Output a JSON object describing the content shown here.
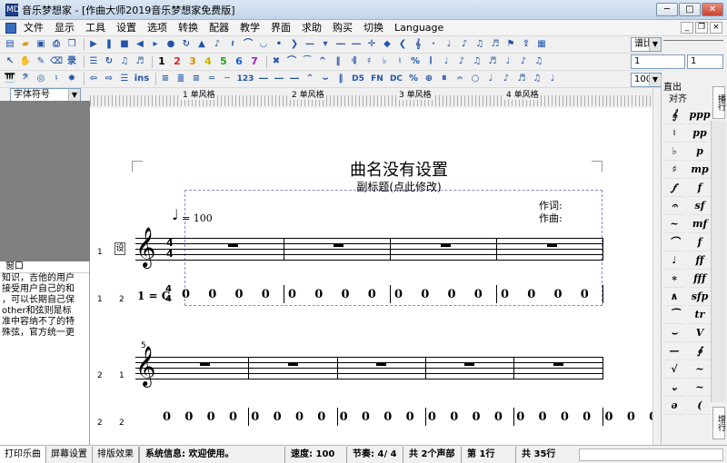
{
  "window": {
    "app_name": "音乐梦想家",
    "title": "音乐梦想家 - [作曲大师2019音乐梦想家免费版]",
    "app_icon_text": "MD"
  },
  "menu": {
    "items": [
      "文件",
      "显示",
      "工具",
      "设置",
      "选项",
      "转换",
      "配器",
      "教学",
      "界面",
      "求助",
      "购买",
      "切换",
      "Language"
    ]
  },
  "toolbar": {
    "row2_numbers": [
      "1",
      "2",
      "3",
      "4",
      "5",
      "6",
      "7"
    ],
    "row3_labels": [
      "ins",
      "123",
      "D5",
      "FN",
      "DC",
      "%"
    ],
    "dropdown_right_1": "谱比",
    "input_right_2a": "1",
    "input_right_2b": "1",
    "zoom": "100%",
    "straight_label": "直出",
    "align_label": "对齐"
  },
  "left_panel": {
    "dropdown": "字体符号",
    "window_header": "窗口",
    "text_lines": [
      "知识，吉他的用户",
      "接受用户自己的和",
      "，可以长期自己保",
      "other和弦则是标",
      "准中容纳不了的特",
      "殊弦，官方统一更"
    ]
  },
  "ruler": {
    "segments": [
      "1  单风格",
      "2  单风格",
      "3  单风格",
      "4  单风格"
    ]
  },
  "score": {
    "title": "曲名没有设置",
    "subtitle": "副标题(点此修改)",
    "lyricist_label": "作词:",
    "composer_label": "作曲:",
    "tempo": "= 100",
    "key_label": "1 = C",
    "time_sig_top": "4",
    "time_sig_bottom": "4",
    "set_box": "设",
    "measure_number_2": "5",
    "row_labels": [
      {
        "part": "1",
        "staff": "1"
      },
      {
        "part": "1",
        "staff": "2"
      },
      {
        "part": "2",
        "staff": "1"
      },
      {
        "part": "2",
        "staff": "2"
      }
    ],
    "numbered_system1": [
      "0",
      "0",
      "0",
      "0",
      "0",
      "0",
      "0",
      "0",
      "0",
      "0",
      "0",
      "0",
      "0",
      "0",
      "0",
      "0"
    ],
    "numbered_system2": [
      "0",
      "0",
      "0",
      "0",
      "0",
      "0",
      "0",
      "0",
      "0",
      "0",
      "0",
      "0",
      "0",
      "0",
      "0",
      "0",
      "0",
      "0",
      "0",
      "0",
      "0",
      "0",
      "0",
      "0"
    ]
  },
  "right_palette": {
    "tab_top": "播行",
    "tab_bottom": "增行",
    "col1": [
      "𝄞",
      "♮",
      "♭",
      "♯",
      "𝆑",
      "𝄐",
      "~",
      "⌒",
      "♩",
      "∗",
      "∧",
      "⁀",
      "⌣",
      "—",
      "√",
      "⌄",
      "ə",
      "∿",
      "♬",
      "☼",
      "♪",
      "⌐",
      "¬"
    ],
    "col2": [
      "ppp",
      "pp",
      "p",
      "mp",
      "f",
      "sf",
      "mf",
      "f",
      "ff",
      "fff",
      "sfp",
      "tr",
      "V",
      "∮",
      "~",
      "~",
      "(",
      ")",
      "⌐",
      "⌒",
      "⌄",
      "∧",
      "⌃"
    ]
  },
  "status": {
    "tabs": [
      "打印乐曲",
      "屏幕设置",
      "排版效果"
    ],
    "message": "系统信息: 欢迎使用。",
    "speed": "速度: 100",
    "beat": "节奏: 4/ 4",
    "parts": "共 2个声部",
    "current_row": "第 1行",
    "total": "共 35行"
  }
}
